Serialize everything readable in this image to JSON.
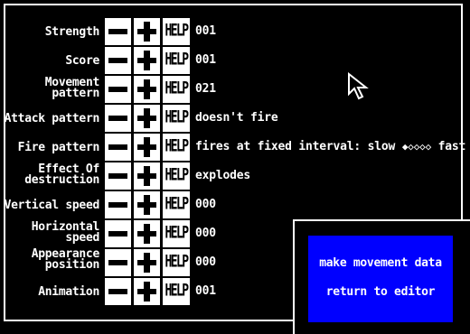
{
  "rows": [
    {
      "label": "Strength",
      "value": "001",
      "two_line": false
    },
    {
      "label": "Score",
      "value": "001",
      "two_line": false
    },
    {
      "label": "Movement pattern",
      "label_l1": "Movement",
      "label_l2": "pattern",
      "value": "021",
      "two_line": true
    },
    {
      "label": "Attack pattern",
      "value": "doesn't fire",
      "two_line": false
    },
    {
      "label": "Fire pattern",
      "value": "fires at fixed interval: slow",
      "value_suffix": "fast",
      "two_line": false
    },
    {
      "label": "Effect Of destruction",
      "label_l1": "Effect Of",
      "label_l2": "destruction",
      "value": "explodes",
      "two_line": true
    },
    {
      "label": "Vertical speed",
      "value": "000",
      "two_line": false
    },
    {
      "label": "Horizontal speed",
      "label_l1": "Horizontal",
      "label_l2": "speed",
      "value": "000",
      "two_line": true
    },
    {
      "label": "Appearance position",
      "label_l1": "Appearance",
      "label_l2": "position",
      "value": "000",
      "two_line": true
    },
    {
      "label": "Animation",
      "value": "001",
      "two_line": false
    }
  ],
  "help_label": "HELP",
  "fire_rate_level": 1,
  "fire_rate_max": 5,
  "menu": {
    "item1": "make movement data",
    "item2": "return to editor"
  },
  "colors": {
    "background": "#000000",
    "foreground": "#ffffff",
    "menu_bg": "#0000ff"
  }
}
